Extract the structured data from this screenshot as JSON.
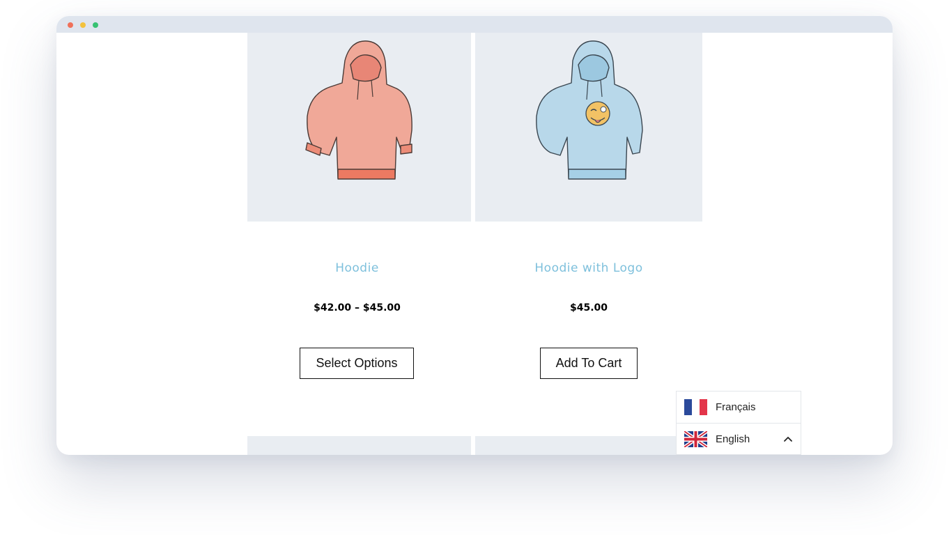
{
  "products": [
    {
      "title": "Hoodie",
      "price": "$42.00 – $45.00",
      "button_label": "Select Options",
      "image_icon": "hoodie-pink-icon",
      "image_color": "#f0a898"
    },
    {
      "title": "Hoodie with Logo",
      "price": "$45.00",
      "button_label": "Add To Cart",
      "image_icon": "hoodie-blue-logo-icon",
      "image_color": "#b8d8ea"
    }
  ],
  "language_switcher": {
    "options": [
      {
        "label": "Français",
        "flag": "france-flag-icon"
      },
      {
        "label": "English",
        "flag": "uk-flag-icon",
        "selected": true
      }
    ]
  },
  "colors": {
    "title_accent": "#7ec0dc",
    "image_bg": "#e9edf2",
    "window_bar": "#dfe5ee"
  }
}
